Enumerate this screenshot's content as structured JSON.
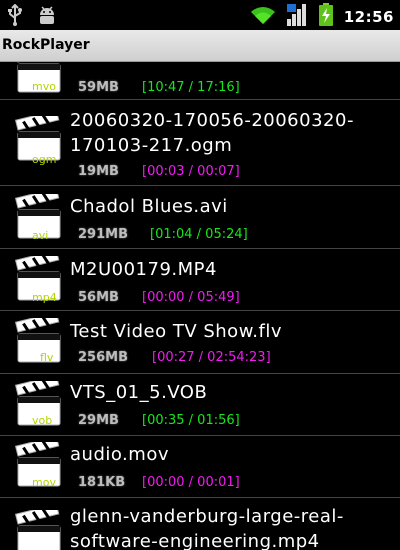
{
  "status_bar": {
    "time": "12:56",
    "left_icons": [
      "usb-icon",
      "android-debug-icon"
    ],
    "right_icons": [
      "wifi-icon",
      "signal-icon",
      "battery-charging-icon"
    ]
  },
  "app": {
    "title": "RockPlayer"
  },
  "files": [
    {
      "name": "(partially visible filename)",
      "ext": "mvo",
      "size": "59MB",
      "time": "[10:47 / 17:16]",
      "time_color": "green"
    },
    {
      "name": "20060320-170056-20060320-170103-217.ogm",
      "name_line1": "20060320-170056-20060320-",
      "name_line2": "170103-217.ogm",
      "ext": "ogm",
      "size": "19MB",
      "time": "[00:03 / 00:07]",
      "time_color": "magenta"
    },
    {
      "name": "Chadol Blues.avi",
      "ext": "avi",
      "size": "291MB",
      "time": "[01:04 / 05:24]",
      "time_color": "green"
    },
    {
      "name": "M2U00179.MP4",
      "ext": "mp4",
      "size": "56MB",
      "time": "[00:00 / 05:49]",
      "time_color": "magenta"
    },
    {
      "name": "Test Video TV Show.flv",
      "ext": "flv",
      "size": "256MB",
      "time": "[00:27 / 02:54:23]",
      "time_color": "magenta"
    },
    {
      "name": "VTS_01_5.VOB",
      "ext": "vob",
      "size": "29MB",
      "time": "[00:35 / 01:56]",
      "time_color": "green"
    },
    {
      "name": "audio.mov",
      "ext": "mov",
      "size": "181KB",
      "time": "[00:00 / 00:01]",
      "time_color": "magenta"
    },
    {
      "name": "glenn-vanderburg-large-real-software-engineering.mp4",
      "name_line1": "glenn-vanderburg-large-real-",
      "name_line2": "software-engineering.mp4",
      "ext": "mp4",
      "size": "",
      "time": "",
      "time_color": ""
    }
  ]
}
